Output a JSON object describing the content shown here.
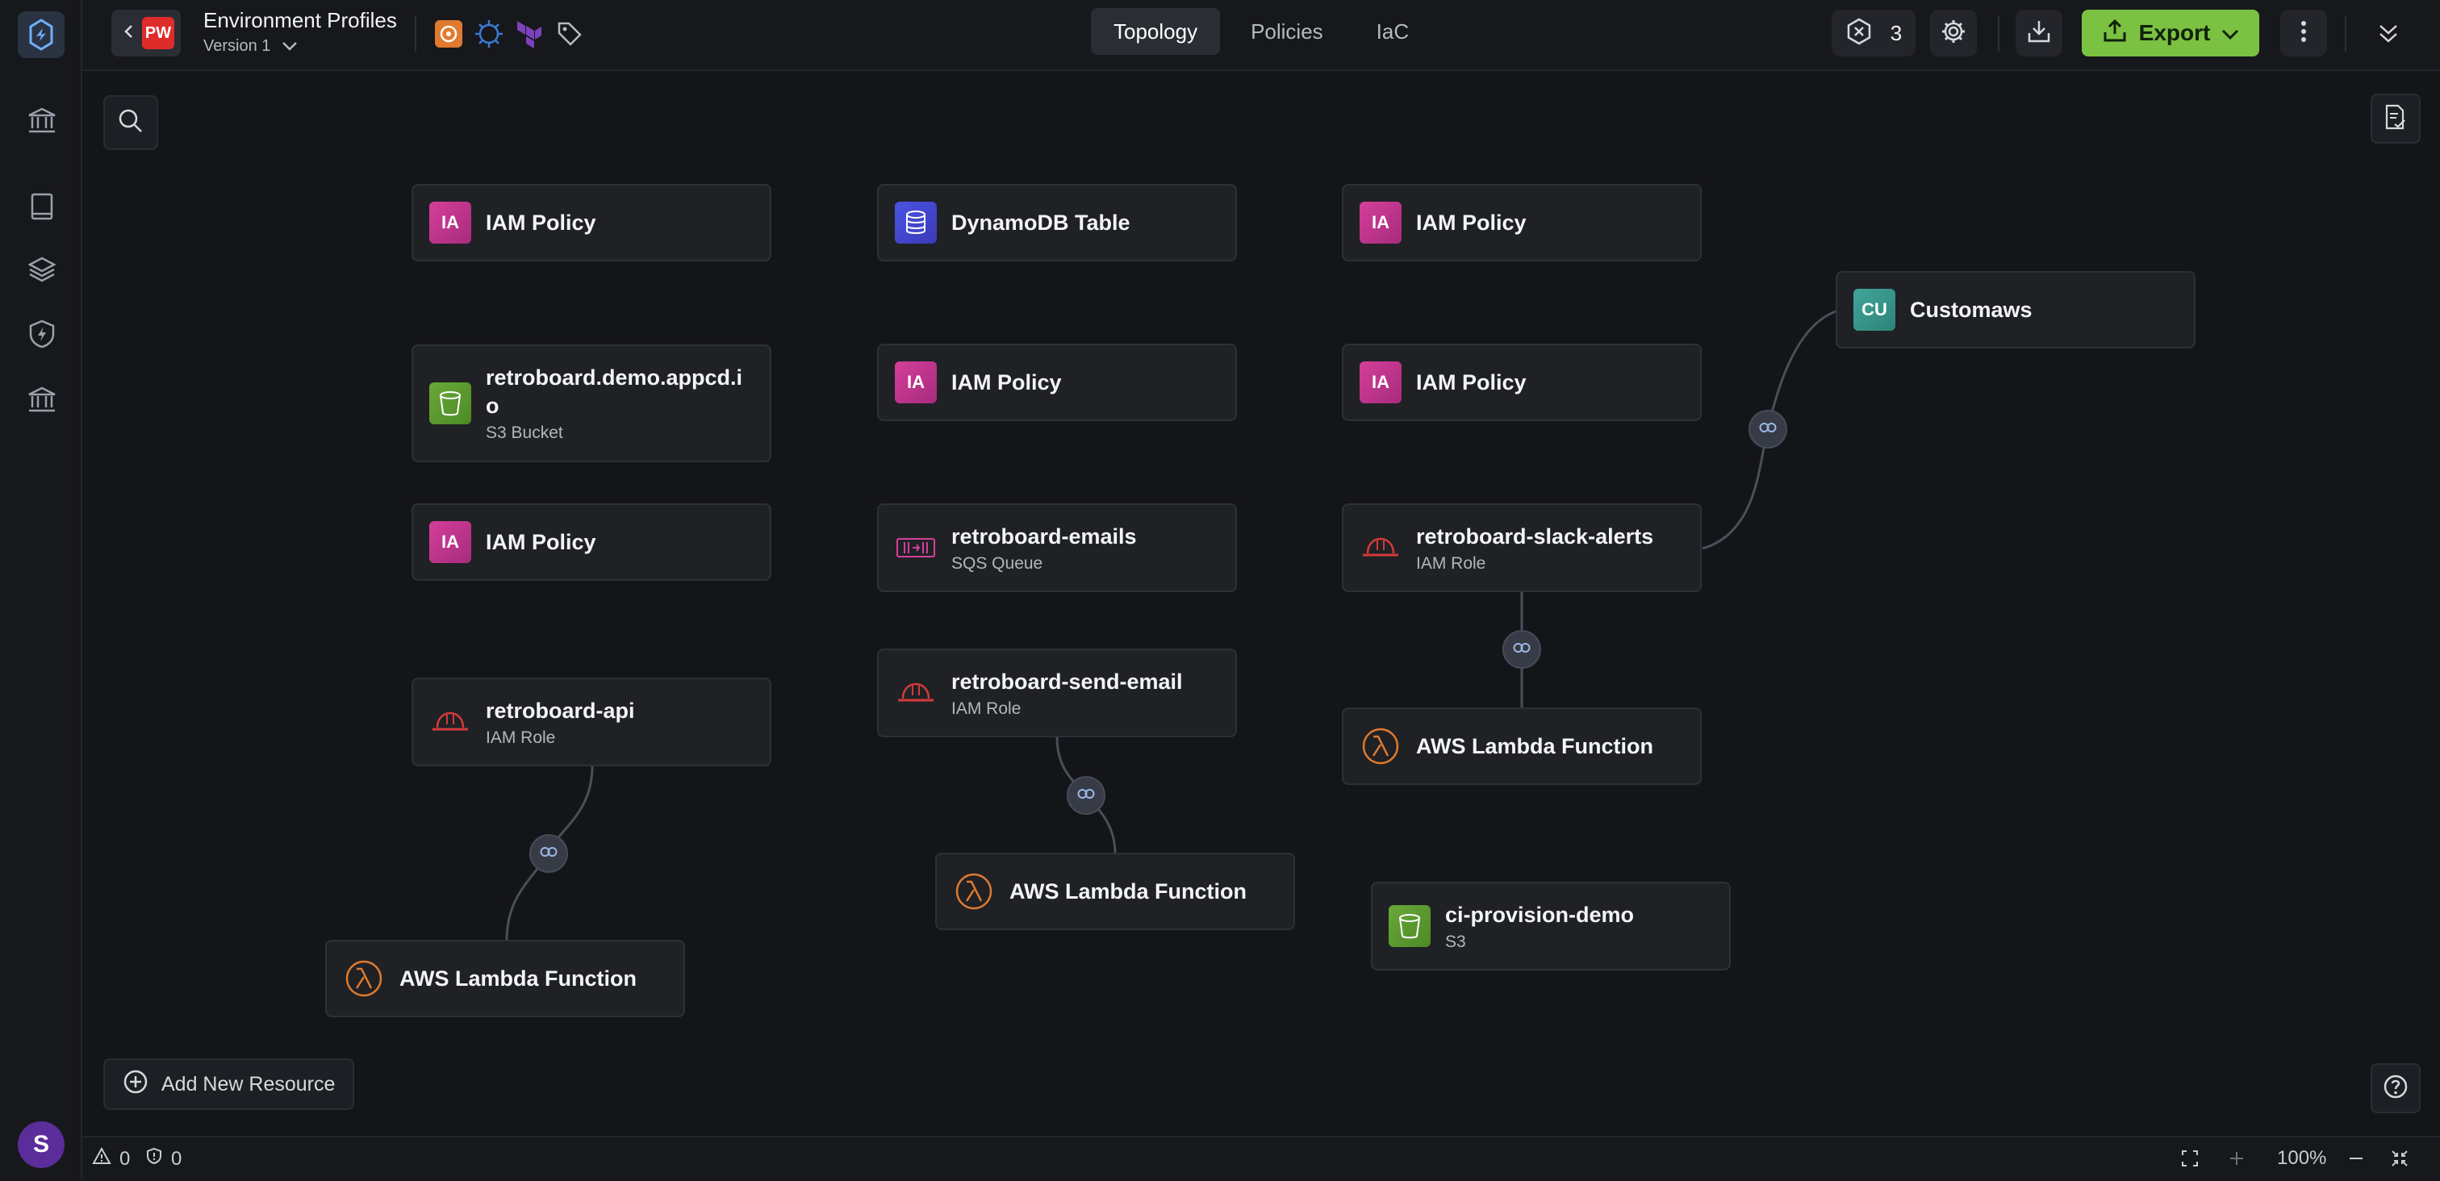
{
  "header": {
    "back_badge": "PW",
    "project_title": "Environment Profiles",
    "version_label": "Version 1",
    "tool_icons": [
      "aws-icon",
      "helm-icon",
      "terraform-icon",
      "tag-icon"
    ],
    "tabs": [
      {
        "label": "Topology",
        "active": true
      },
      {
        "label": "Policies",
        "active": false
      },
      {
        "label": "IaC",
        "active": false
      }
    ],
    "issues_count": "3",
    "export_label": "Export"
  },
  "nodes": [
    {
      "title": "IAM Policy",
      "badge": "IA",
      "kind": "iam-policy"
    },
    {
      "title": "DynamoDB Table",
      "kind": "dynamodb"
    },
    {
      "title": "IAM Policy",
      "badge": "IA",
      "kind": "iam-policy"
    },
    {
      "title": "Customaws",
      "badge": "CU",
      "kind": "custom"
    },
    {
      "title": "retroboard.demo.appcd.io",
      "subtitle": "S3 Bucket",
      "kind": "s3"
    },
    {
      "title": "IAM Policy",
      "badge": "IA",
      "kind": "iam-policy"
    },
    {
      "title": "IAM Policy",
      "badge": "IA",
      "kind": "iam-policy"
    },
    {
      "title": "IAM Policy",
      "badge": "IA",
      "kind": "iam-policy"
    },
    {
      "title": "retroboard-emails",
      "subtitle": "SQS Queue",
      "kind": "sqs"
    },
    {
      "title": "retroboard-slack-alerts",
      "subtitle": "IAM Role",
      "kind": "iam-role"
    },
    {
      "title": "retroboard-api",
      "subtitle": "IAM Role",
      "kind": "iam-role"
    },
    {
      "title": "retroboard-send-email",
      "subtitle": "IAM Role",
      "kind": "iam-role"
    },
    {
      "title": "AWS Lambda Function",
      "kind": "lambda"
    },
    {
      "title": "AWS Lambda Function",
      "kind": "lambda"
    },
    {
      "title": "AWS Lambda Function",
      "kind": "lambda"
    },
    {
      "title": "ci-provision-demo",
      "subtitle": "S3",
      "kind": "s3"
    }
  ],
  "canvas": {
    "add_resource_label": "Add New Resource"
  },
  "status": {
    "warnings": "0",
    "errors": "0",
    "zoom": "100%"
  },
  "user": {
    "avatar_initial": "S"
  },
  "colors": {
    "accent_green": "#7bc142",
    "iam_pink": "#d43f9a",
    "lambda_orange": "#e07a2e"
  }
}
